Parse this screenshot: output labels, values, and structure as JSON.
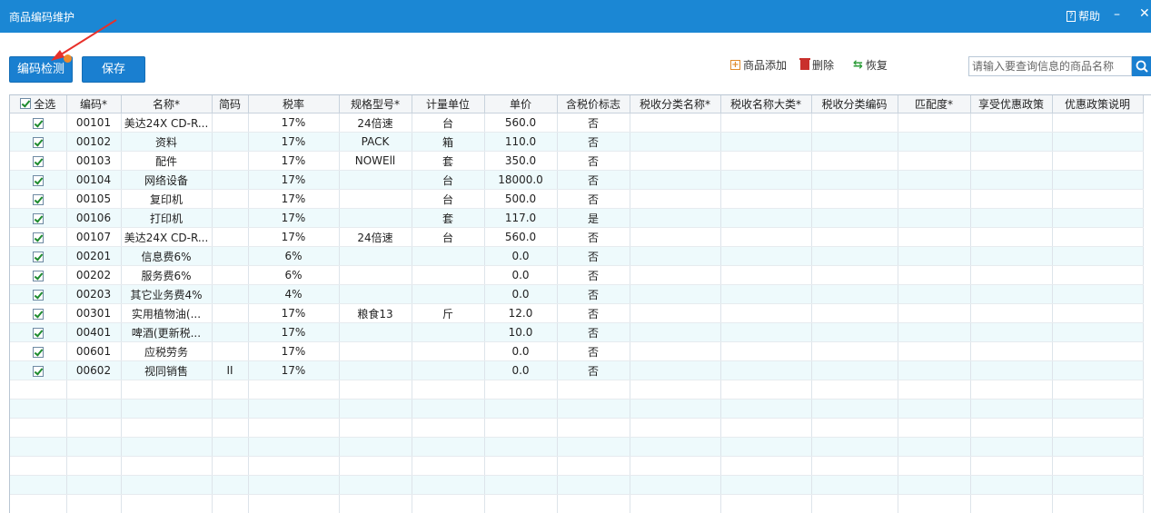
{
  "window": {
    "title": "商品编码维护",
    "help_label": "帮助",
    "minimize": "–",
    "close": "✕"
  },
  "buttons": {
    "check_label": "编码检测",
    "save_label": "保存"
  },
  "toolbar": {
    "add_label": "商品添加",
    "delete_label": "删除",
    "restore_label": "恢复"
  },
  "search": {
    "placeholder": "请输入要查询信息的商品名称",
    "value": ""
  },
  "icons": {
    "add": "add-box-icon",
    "delete": "trash-icon",
    "restore": "refresh-icon",
    "search": "search-icon",
    "help": "help-doc-icon"
  },
  "colors": {
    "titlebar": "#1b87d4",
    "button": "#1a7fd0",
    "row_alt": "#eefafc",
    "check": "#1e8b2e"
  },
  "table": {
    "select_all_label": "全选",
    "columns": [
      "编码*",
      "名称*",
      "简码",
      "税率",
      "规格型号*",
      "计量单位",
      "单价",
      "含税价标志",
      "税收分类名称*",
      "税收名称大类*",
      "税收分类编码",
      "匹配度*",
      "享受优惠政策",
      "优惠政策说明"
    ],
    "rows": [
      {
        "code": "00101",
        "name": "美达24X CD-R...",
        "short": "",
        "tax": "17%",
        "spec": "24倍速",
        "unit": "台",
        "price": "560.0",
        "incl": "否"
      },
      {
        "code": "00102",
        "name": "资料",
        "short": "",
        "tax": "17%",
        "spec": "PACK",
        "unit": "箱",
        "price": "110.0",
        "incl": "否"
      },
      {
        "code": "00103",
        "name": "配件",
        "short": "",
        "tax": "17%",
        "spec": "NOWEll",
        "unit": "套",
        "price": "350.0",
        "incl": "否"
      },
      {
        "code": "00104",
        "name": "网络设备",
        "short": "",
        "tax": "17%",
        "spec": "",
        "unit": "台",
        "price": "18000.0",
        "incl": "否"
      },
      {
        "code": "00105",
        "name": "复印机",
        "short": "",
        "tax": "17%",
        "spec": "",
        "unit": "台",
        "price": "500.0",
        "incl": "否"
      },
      {
        "code": "00106",
        "name": "打印机",
        "short": "",
        "tax": "17%",
        "spec": "",
        "unit": "套",
        "price": "117.0",
        "incl": "是"
      },
      {
        "code": "00107",
        "name": "美达24X CD-R...",
        "short": "",
        "tax": "17%",
        "spec": "24倍速",
        "unit": "台",
        "price": "560.0",
        "incl": "否"
      },
      {
        "code": "00201",
        "name": "信息费6%",
        "short": "",
        "tax": "6%",
        "spec": "",
        "unit": "",
        "price": "0.0",
        "incl": "否"
      },
      {
        "code": "00202",
        "name": "服务费6%",
        "short": "",
        "tax": "6%",
        "spec": "",
        "unit": "",
        "price": "0.0",
        "incl": "否"
      },
      {
        "code": "00203",
        "name": "其它业务费4%",
        "short": "",
        "tax": "4%",
        "spec": "",
        "unit": "",
        "price": "0.0",
        "incl": "否"
      },
      {
        "code": "00301",
        "name": "实用植物油(...",
        "short": "",
        "tax": "17%",
        "spec": "粮食13",
        "unit": "斤",
        "price": "12.0",
        "incl": "否"
      },
      {
        "code": "00401",
        "name": "啤酒(更新税...",
        "short": "",
        "tax": "17%",
        "spec": "",
        "unit": "",
        "price": "10.0",
        "incl": "否"
      },
      {
        "code": "00601",
        "name": "应税劳务",
        "short": "",
        "tax": "17%",
        "spec": "",
        "unit": "",
        "price": "0.0",
        "incl": "否"
      },
      {
        "code": "00602",
        "name": "视同销售",
        "short": "II",
        "tax": "17%",
        "spec": "",
        "unit": "",
        "price": "0.0",
        "incl": "否"
      }
    ]
  }
}
